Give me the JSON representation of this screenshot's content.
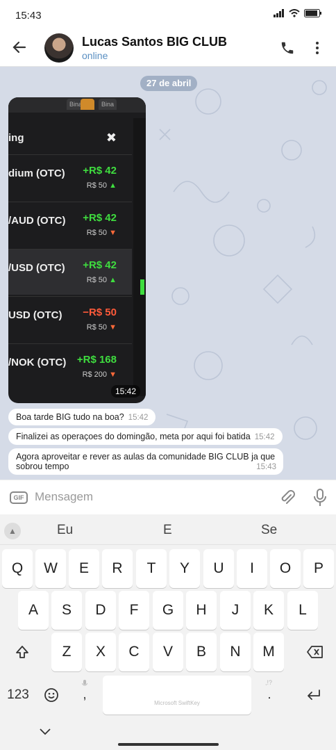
{
  "status_bar": {
    "time": "15:43"
  },
  "header": {
    "contact_name": "Lucas Santos BIG CLUB",
    "status": "online"
  },
  "chat": {
    "date_pill": "27 de abril",
    "photo": {
      "tabs": [
        "Bina",
        "Bina"
      ],
      "panel_title": "ing",
      "rows": [
        {
          "asset": "dium (OTC)",
          "pl": "+R$ 42",
          "stake": "R$ 50",
          "dir": "up",
          "selected": false
        },
        {
          "asset": "/AUD (OTC)",
          "pl": "+R$ 42",
          "stake": "R$ 50",
          "dir": "down",
          "selected": false
        },
        {
          "asset": "/USD (OTC)",
          "pl": "+R$ 42",
          "stake": "R$ 50",
          "dir": "up",
          "selected": true
        },
        {
          "asset": "USD (OTC)",
          "pl": "−R$ 50",
          "stake": "R$ 50",
          "dir": "down",
          "selected": false
        },
        {
          "asset": "/NOK (OTC)",
          "pl": "+R$ 168",
          "stake": "R$ 200",
          "dir": "down",
          "selected": false
        }
      ],
      "time": "15:42"
    },
    "messages": [
      {
        "text": "Boa tarde BIG tudo na boa?",
        "time": "15:42"
      },
      {
        "text": "Finalizei as operaçoes do domingão, meta por aqui foi batida",
        "time": "15:42"
      },
      {
        "text": "Agora aproveitar e rever as aulas da comunidade BIG CLUB  ja que sobrou tempo",
        "time": "15:43"
      }
    ]
  },
  "input": {
    "gif_label": "GIF",
    "placeholder": "Mensagem"
  },
  "keyboard": {
    "suggestions": [
      "Eu",
      "E",
      "Se"
    ],
    "row1": [
      "Q",
      "W",
      "E",
      "R",
      "T",
      "Y",
      "U",
      "I",
      "O",
      "P"
    ],
    "row2": [
      "A",
      "S",
      "D",
      "F",
      "G",
      "H",
      "J",
      "K",
      "L"
    ],
    "row3": [
      "Z",
      "X",
      "C",
      "V",
      "B",
      "N",
      "M"
    ],
    "num_label": "123",
    "comma": ",",
    "period": ".",
    "punct_hint": ",!?",
    "space_label": "Microsoft SwiftKey"
  },
  "colors": {
    "gain": "#3fdd3f",
    "loss": "#ff5a3a",
    "accent": "#5a8fc2",
    "chat_bg": "#d5dbe7"
  }
}
